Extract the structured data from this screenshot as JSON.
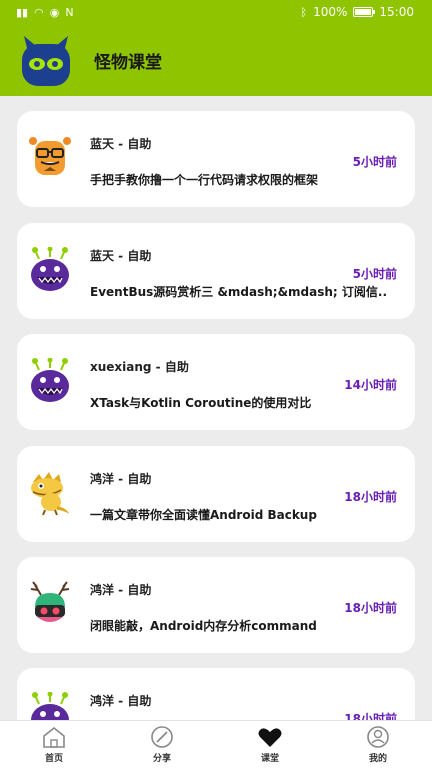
{
  "status_bar": {
    "battery": "100%",
    "time": "15:00"
  },
  "header": {
    "title": "怪物课堂"
  },
  "articles": [
    {
      "author": "蓝天 - 自助",
      "time": "5小时前",
      "title": "手把手教你撸一个一行代码请求权限的框架",
      "avatar": "orange-monster-glasses"
    },
    {
      "author": "蓝天 - 自助",
      "time": "5小时前",
      "title": "EventBus源码赏析三 &mdash;&mdash; 订阅信..",
      "avatar": "purple-monster-antennae"
    },
    {
      "author": "xuexiang - 自助",
      "time": "14小时前",
      "title": "XTask与Kotlin Coroutine的使用对比",
      "avatar": "purple-monster-antennae"
    },
    {
      "author": "鸿洋 - 自助",
      "time": "18小时前",
      "title": "一篇文章带你全面读懂Android Backup",
      "avatar": "yellow-dragon-monster"
    },
    {
      "author": "鸿洋 - 自助",
      "time": "18小时前",
      "title": "闭眼能敲，Android内存分析command",
      "avatar": "green-antler-monster"
    },
    {
      "author": "鸿洋 - 自助",
      "time": "18小时前",
      "title": "",
      "avatar": "purple-monster-antennae"
    }
  ],
  "nav": {
    "items": [
      {
        "label": "首页",
        "icon": "home-icon"
      },
      {
        "label": "分享",
        "icon": "compass-icon"
      },
      {
        "label": "课堂",
        "icon": "heart-icon"
      },
      {
        "label": "我的",
        "icon": "profile-icon"
      }
    ],
    "active": "课堂"
  },
  "colors": {
    "brand_green": "#8ec400",
    "time_purple": "#6a1fb4",
    "background": "#ececec"
  }
}
